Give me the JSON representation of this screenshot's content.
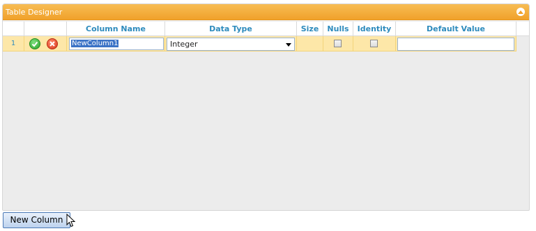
{
  "panel": {
    "title": "Table Designer"
  },
  "grid": {
    "columns": [
      "",
      "",
      "Column Name",
      "Data Type",
      "Size",
      "Nulls",
      "Identity",
      "Default Value"
    ],
    "row": {
      "number": "1",
      "column_name": "NewColumn1",
      "data_type": "Integer",
      "size": "",
      "nulls_checked": false,
      "identity_checked": false,
      "default_value": ""
    }
  },
  "buttons": {
    "new_column": "New Column"
  },
  "colors": {
    "header_orange": "#f0a12a",
    "row_highlight": "#fde7a8",
    "header_text": "#2d8bbd"
  }
}
